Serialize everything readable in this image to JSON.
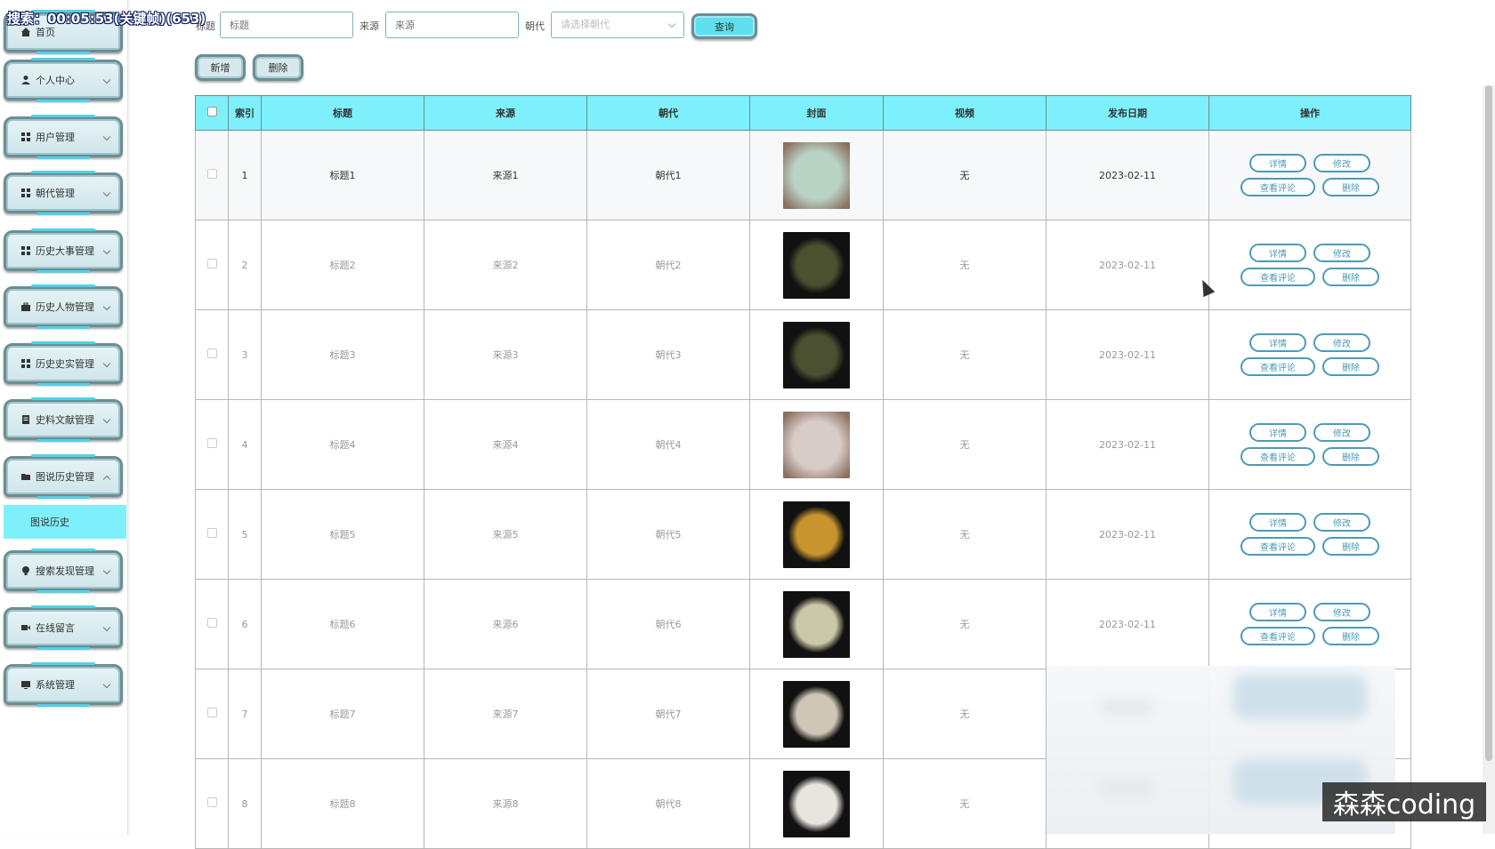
{
  "overlay": {
    "timer": "搜索：00:05:53(关键帧)(653)",
    "watermark": "森森coding"
  },
  "sidebar": {
    "items": [
      {
        "label": "首页",
        "icon": "home-icon"
      },
      {
        "label": "个人中心",
        "icon": "user-icon"
      },
      {
        "label": "用户管理",
        "icon": "grid-icon"
      },
      {
        "label": "朝代管理",
        "icon": "grid-icon"
      },
      {
        "label": "历史大事管理",
        "icon": "grid-icon"
      },
      {
        "label": "历史人物管理",
        "icon": "briefcase-icon"
      },
      {
        "label": "历史史实管理",
        "icon": "grid-icon"
      },
      {
        "label": "史料文献管理",
        "icon": "document-icon"
      },
      {
        "label": "图说历史管理",
        "icon": "folder-icon"
      },
      {
        "label": "搜索发现管理",
        "icon": "bulb-icon"
      },
      {
        "label": "在线留言",
        "icon": "video-icon"
      },
      {
        "label": "系统管理",
        "icon": "monitor-icon"
      }
    ],
    "subitem": "图说历史"
  },
  "search": {
    "title_label": "标题",
    "title_placeholder": "标题",
    "source_label": "来源",
    "source_placeholder": "来源",
    "dynasty_label": "朝代",
    "dynasty_placeholder": "请选择朝代",
    "query_button": "查询"
  },
  "actions": {
    "add": "新增",
    "delete": "删除"
  },
  "table": {
    "headers": [
      "索引",
      "标题",
      "来源",
      "朝代",
      "封面",
      "视频",
      "发布日期",
      "操作"
    ],
    "op_labels": {
      "detail": "详情",
      "edit": "修改",
      "comments": "查看评论",
      "delete": "删除"
    },
    "rows": [
      {
        "index": "1",
        "title": "标题1",
        "source": "来源1",
        "dynasty": "朝代1",
        "video": "无",
        "date": "2023-02-11",
        "thumb": "#b9d3c4"
      },
      {
        "index": "2",
        "title": "标题2",
        "source": "来源2",
        "dynasty": "朝代2",
        "video": "无",
        "date": "2023-02-11",
        "thumb": "#4a5030"
      },
      {
        "index": "3",
        "title": "标题3",
        "source": "来源3",
        "dynasty": "朝代3",
        "video": "无",
        "date": "2023-02-11",
        "thumb": "#4a5030"
      },
      {
        "index": "4",
        "title": "标题4",
        "source": "来源4",
        "dynasty": "朝代4",
        "video": "无",
        "date": "2023-02-11",
        "thumb": "#d8ccc8"
      },
      {
        "index": "5",
        "title": "标题5",
        "source": "来源5",
        "dynasty": "朝代5",
        "video": "无",
        "date": "2023-02-11",
        "thumb": "#c8942e"
      },
      {
        "index": "6",
        "title": "标题6",
        "source": "来源6",
        "dynasty": "朝代6",
        "video": "无",
        "date": "2023-02-11",
        "thumb": "#c9c8a8"
      },
      {
        "index": "7",
        "title": "标题7",
        "source": "来源7",
        "dynasty": "朝代7",
        "video": "无",
        "date": "",
        "thumb": "#cfc6b6"
      },
      {
        "index": "8",
        "title": "标题8",
        "source": "来源8",
        "dynasty": "朝代8",
        "video": "无",
        "date": "",
        "thumb": "#e8e4de"
      }
    ]
  },
  "colors": {
    "accent_cyan": "#7ef0fb",
    "frame": "#6b8e95",
    "op_button": "#4c9ab6"
  }
}
